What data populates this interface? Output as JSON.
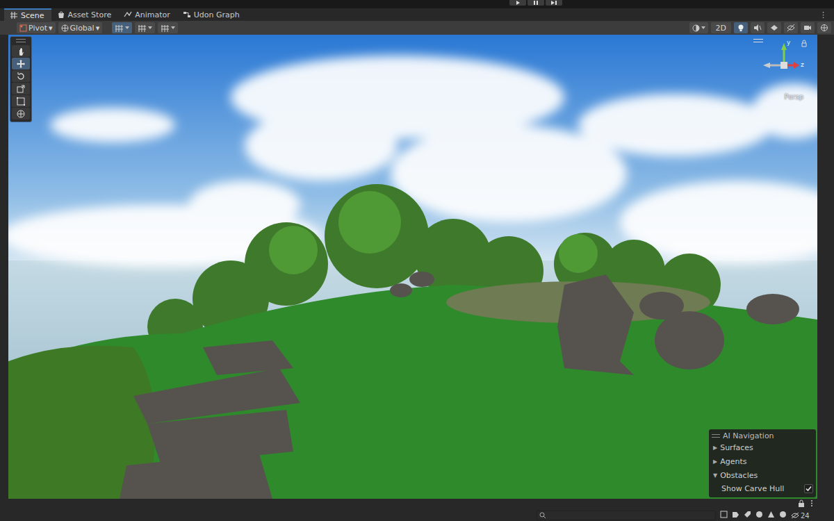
{
  "tabs": [
    {
      "label": "Scene",
      "kind": "scene",
      "selected": true
    },
    {
      "label": "Asset Store",
      "kind": "store",
      "selected": false
    },
    {
      "label": "Animator",
      "kind": "animator",
      "selected": false
    },
    {
      "label": "Udon Graph",
      "kind": "graph",
      "selected": false
    }
  ],
  "tab_menu": "⋮",
  "toolbar": {
    "pivot": "Pivot",
    "global": "Global",
    "dropdown_arrow": "▾",
    "two_d": {
      "label": "2D",
      "selected": false
    },
    "lighting": {
      "selected": true
    }
  },
  "tools": [
    {
      "kind": "hand",
      "selected": false
    },
    {
      "kind": "move",
      "selected": true
    },
    {
      "kind": "rotate",
      "selected": false
    },
    {
      "kind": "scale",
      "selected": false
    },
    {
      "kind": "rect",
      "selected": false
    },
    {
      "kind": "transform",
      "selected": false
    }
  ],
  "gizmo": {
    "label": "Persp",
    "axes": [
      "y",
      "z"
    ]
  },
  "ai_navigation": {
    "title": "AI Navigation",
    "sections": [
      {
        "label": "Surfaces",
        "arrow": "▶",
        "expanded": false,
        "options": []
      },
      {
        "label": "Agents",
        "arrow": "▶",
        "expanded": false,
        "options": []
      },
      {
        "label": "Obstacles",
        "arrow": "▼",
        "expanded": true,
        "options": [
          {
            "label": "Show Carve Hull",
            "checked": true
          }
        ]
      }
    ]
  },
  "status_bar": {
    "hidden_count": "24"
  }
}
